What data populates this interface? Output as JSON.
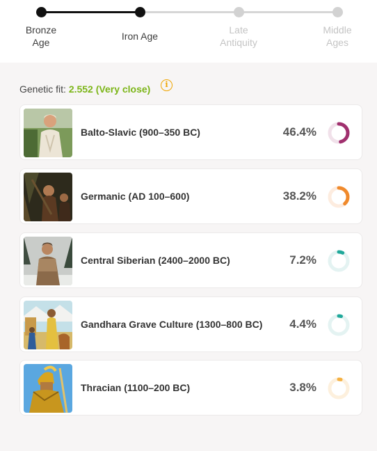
{
  "timeline": {
    "stages": [
      {
        "label": "Bronze\nAge",
        "active": true
      },
      {
        "label": "Iron Age",
        "active": true
      },
      {
        "label": "Late\nAntiquity",
        "active": false
      },
      {
        "label": "Middle\nAges",
        "active": false
      }
    ]
  },
  "genetic_fit": {
    "label": "Genetic fit:",
    "value": "2.552 (Very close)",
    "icon": "info-icon",
    "accent_color": "#7cb518"
  },
  "populations": [
    {
      "name": "Balto-Slavic (900–350 BC)",
      "percent_label": "46.4%",
      "percent": 46.4,
      "color": "#a0306e",
      "track_color": "#f1e1ea"
    },
    {
      "name": "Germanic (AD 100–600)",
      "percent_label": "38.2%",
      "percent": 38.2,
      "color": "#f08a2c",
      "track_color": "#fdecdf"
    },
    {
      "name": "Central Siberian (2400–2000 BC)",
      "percent_label": "7.2%",
      "percent": 7.2,
      "color": "#1fa89a",
      "track_color": "#e4f3f2"
    },
    {
      "name": "Gandhara Grave Culture (1300–800 BC)",
      "percent_label": "4.4%",
      "percent": 4.4,
      "color": "#1fa89a",
      "track_color": "#e4f3f2"
    },
    {
      "name": "Thracian (1100–200 BC)",
      "percent_label": "3.8%",
      "percent": 3.8,
      "color": "#f5b040",
      "track_color": "#fdf0dd"
    }
  ]
}
